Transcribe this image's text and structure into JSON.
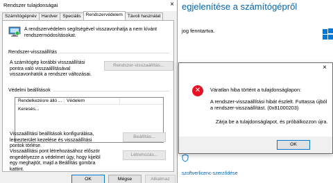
{
  "background": {
    "heading": "egjelenítése a számítógépről",
    "text": "jog fenntartva.",
    "link": "szoftverlicenc-szerződése"
  },
  "sysprops": {
    "title": "Rendszer tulajdonságai",
    "close": "×",
    "tabs": [
      "Számítógépnév",
      "Hardver",
      "Speciális",
      "Rendszervédelem",
      "Távoli használat"
    ],
    "intro": "A rendszervédelem segítségével visszavonhatja a nem kívánt rendszermódosításokat.",
    "restore": {
      "title": "Rendszer-visszaállítás",
      "description": "A számítógép korábbi visszaállítási pontra való visszaállításával visszavonhatók a rendszer változásai.",
      "button": "Rendszer-visszaállítás..."
    },
    "protection": {
      "title": "Védelmi beállítások",
      "columns": [
        "Rendelkezésre álló ...",
        "Védelem"
      ],
      "row": "Keresés...",
      "configure_text": "Visszaállítási beállítások konfigurálása, lemezterület kezelése és visszaállítási pontok törlése.",
      "configure_button": "Beállítás...",
      "create_text": "Visszaállítási pont létrehozásához először engedélyezze a védelmet úgy, hogy kijelöl egy meghajtót, majd a Beállítás gombra kattint.",
      "create_button": "Létrehozás..."
    },
    "footer": {
      "ok": "OK",
      "cancel": "Mégse",
      "apply": "Alkalmaz"
    }
  },
  "error_dialog": {
    "close": "×",
    "icon": "error-icon",
    "heading": "Váratlan hiba történt a tulajdonságlapon:",
    "message": "A rendszer-visszaállítási hibát észlelt. Futtassa újból a rendszer-visszaállítást. (0x81000203)",
    "message2": "Zárja be a tulajdonságlapot, és próbálkozzon újra.",
    "ok": "OK"
  },
  "colors": {
    "accent": "#0078d7",
    "error": "#e81123",
    "link": "#0063b1"
  }
}
